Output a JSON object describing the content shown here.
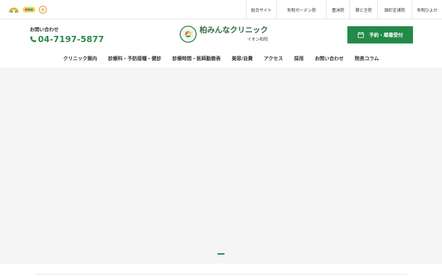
{
  "topbar": {
    "links": [
      "総合サイト",
      "有明ガーデン院",
      "豊洲院",
      "勝どき院",
      "田町芝浦院",
      "有明ひよか"
    ]
  },
  "header": {
    "contact_label": "お問い合わせ",
    "phone": "04-7197-5877",
    "logo_name": "柏みんなクリニック",
    "logo_branch": "イオン柏院",
    "reserve_label": "予約・順番受付"
  },
  "nav": {
    "items": [
      "クリニック案内",
      "診療科・予防接種・健診",
      "診療時間・医師勤務表",
      "美容/自費",
      "アクセス",
      "採用",
      "お問い合わせ",
      "院長コラム"
    ]
  },
  "colors": {
    "accent": "#238a48",
    "phone": "#2a8a4a",
    "hero_background": "#f5f5f5"
  },
  "icons": {
    "phone": "phone-icon",
    "calendar": "calendar-icon",
    "clinic_logo": "clinic-logo-icon"
  },
  "slider": {
    "active_slide": 1
  }
}
